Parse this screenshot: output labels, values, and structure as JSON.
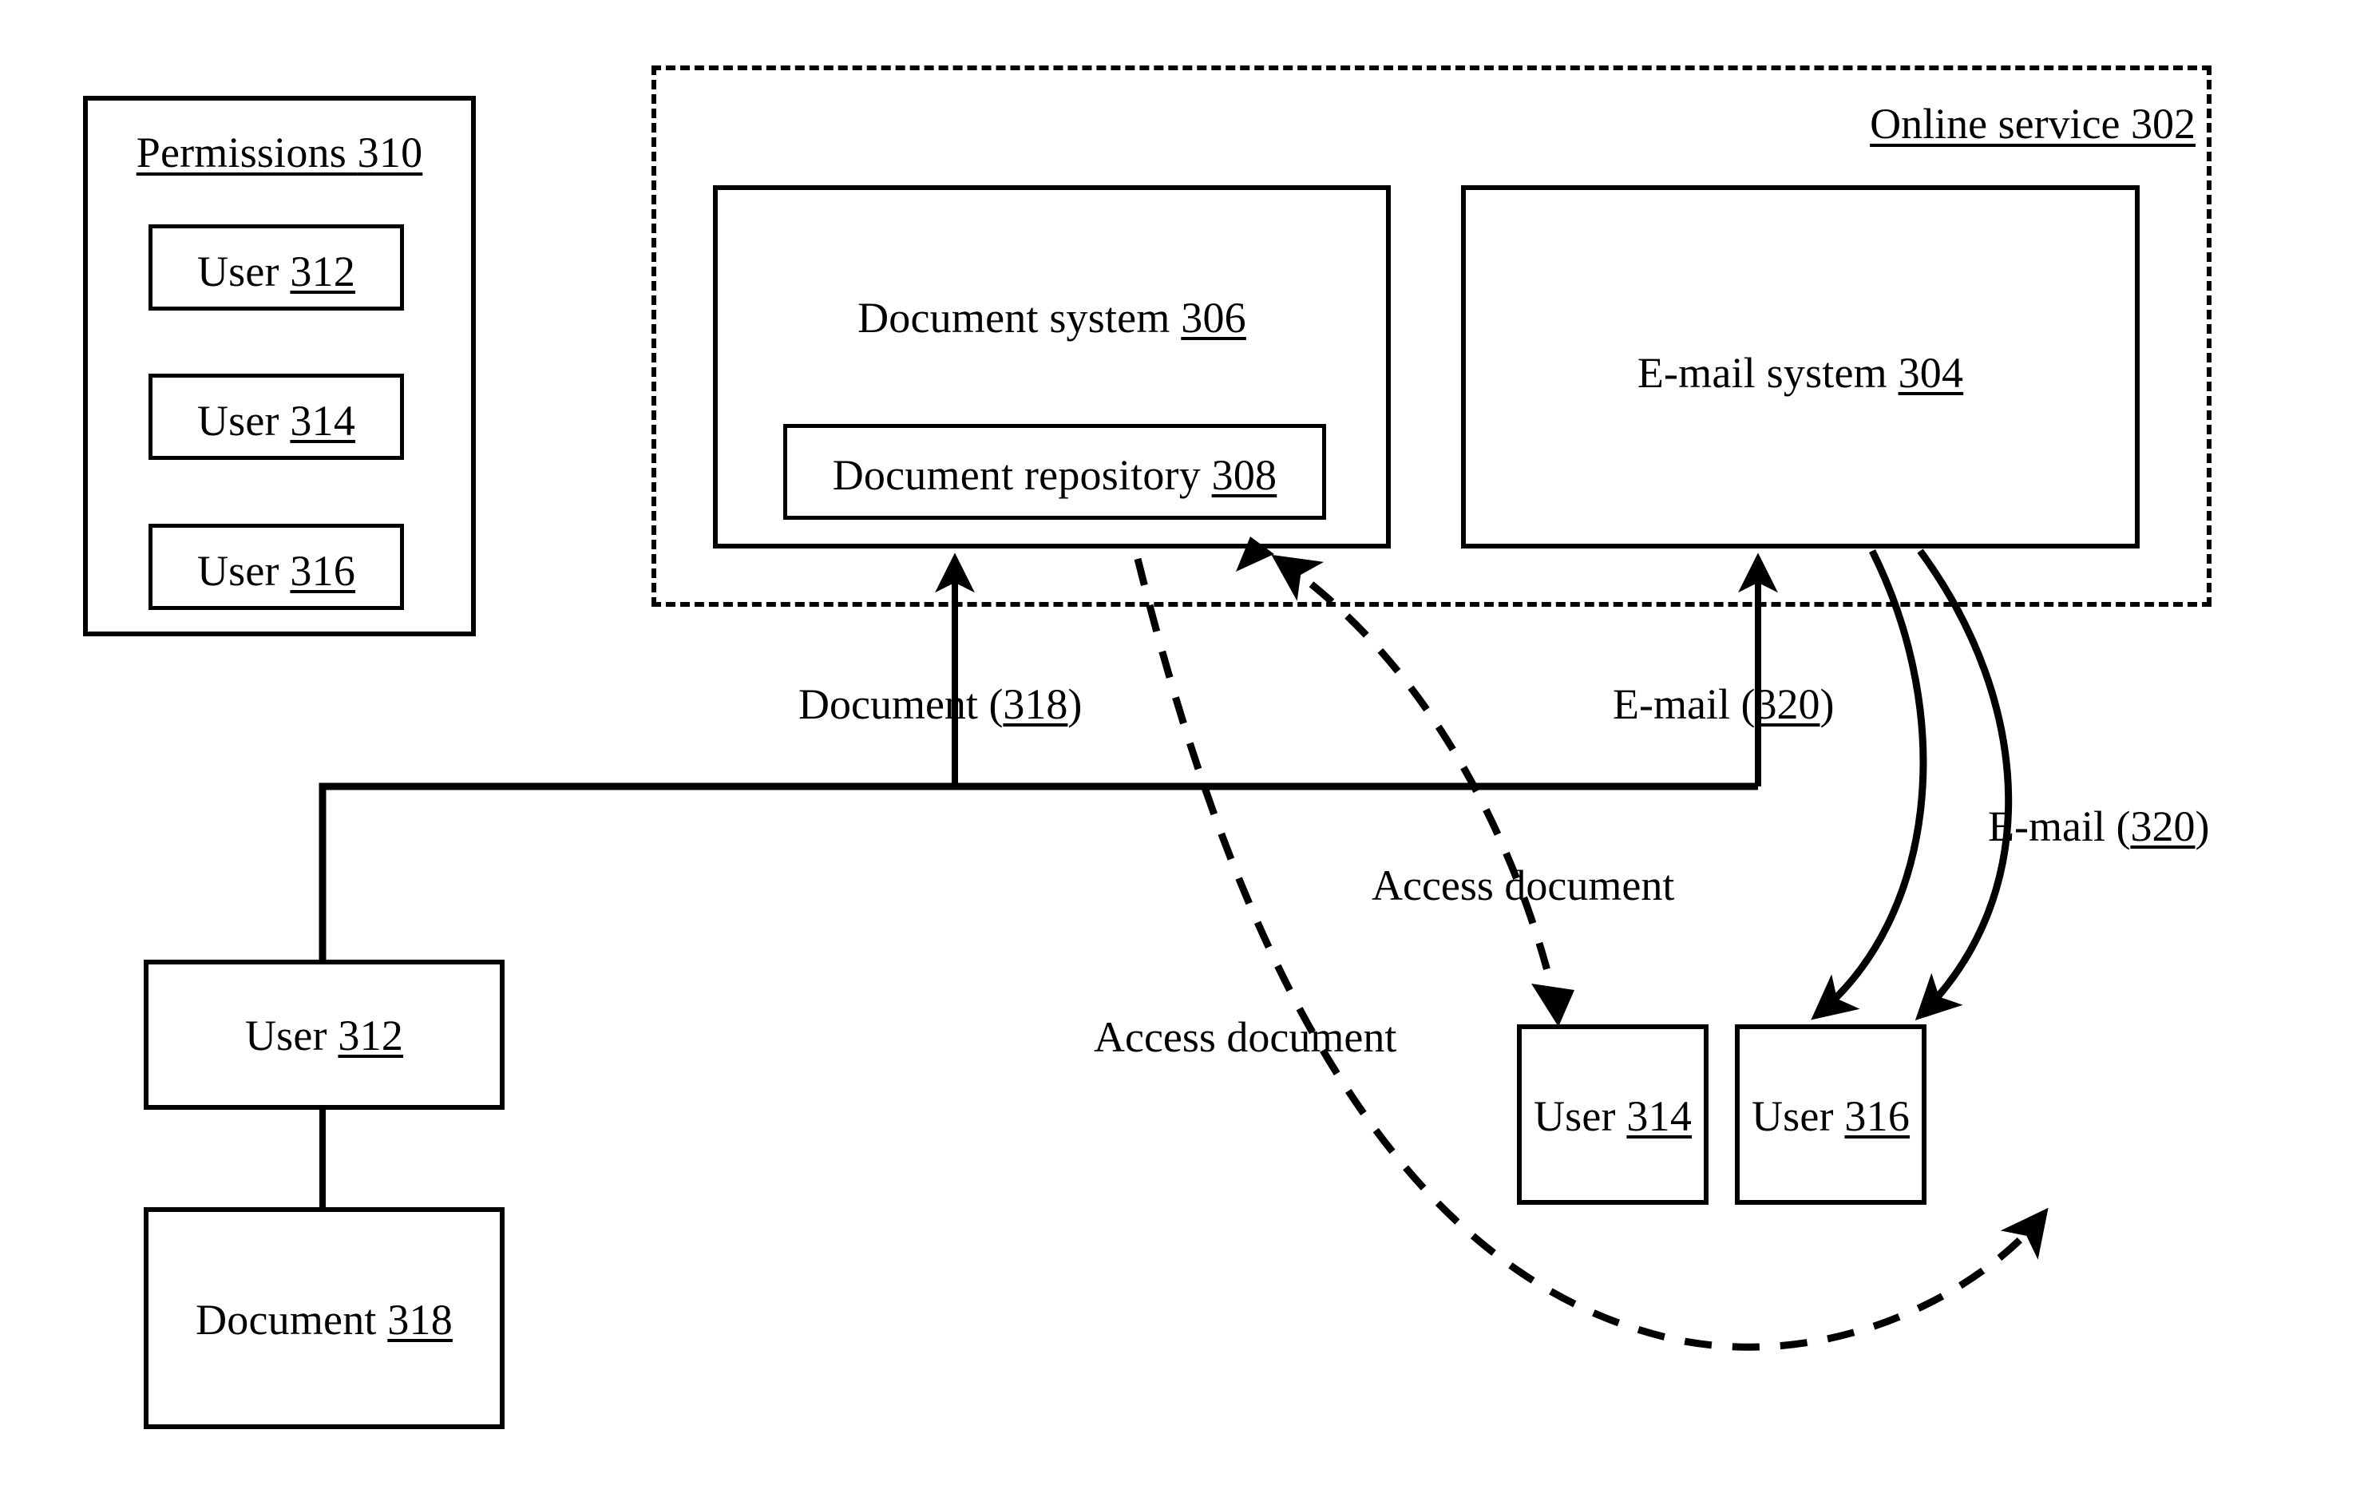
{
  "figure": {
    "title": "Online service document and e-mail sharing diagram",
    "background_color": "#ffffff",
    "line_color": "#000000"
  },
  "permissions_panel": {
    "title_text": "Permissions",
    "title_ref": "310",
    "items": [
      {
        "label": "User",
        "ref": "312"
      },
      {
        "label": "User",
        "ref": "314"
      },
      {
        "label": "User",
        "ref": "316"
      }
    ]
  },
  "online_service": {
    "label": "Online service",
    "ref": "302",
    "systems": [
      {
        "name": "document-system",
        "label": "Document system",
        "ref": "306",
        "child": {
          "name": "document-repository",
          "label": "Document repository",
          "ref": "308"
        }
      },
      {
        "name": "email-system",
        "label": "E-mail system",
        "ref": "304",
        "child": null
      }
    ]
  },
  "actors": {
    "user_312": {
      "label": "User",
      "ref": "312"
    },
    "user_314": {
      "label": "User",
      "ref": "314"
    },
    "user_316": {
      "label": "User",
      "ref": "316"
    },
    "document_318": {
      "label": "Document",
      "ref": "318"
    }
  },
  "flow_labels": {
    "document_upload": {
      "prefix": "Document (",
      "ref": "318",
      "suffix": ")"
    },
    "email_send": {
      "prefix": "E-mail (",
      "ref": "320",
      "suffix": ")"
    },
    "email_deliver": {
      "prefix": "E-mail (",
      "ref": "320",
      "suffix": ")"
    },
    "access_document_314": "Access document",
    "access_document_316": "Access document"
  },
  "edges": [
    {
      "name": "user312-to-document318",
      "style": "solid",
      "arrow": false,
      "from": "user-312",
      "to": "document-318"
    },
    {
      "name": "document318-upload-to-document-system",
      "style": "solid",
      "arrow": true,
      "from": "user-312",
      "to": "document-system"
    },
    {
      "name": "email320-to-email-system",
      "style": "solid",
      "arrow": true,
      "from": "user-312",
      "to": "email-system"
    },
    {
      "name": "email-system-to-user314",
      "style": "solid",
      "arrow": true,
      "from": "email-system",
      "to": "user-314"
    },
    {
      "name": "email-system-to-user316",
      "style": "solid",
      "arrow": true,
      "from": "email-system",
      "to": "user-316"
    },
    {
      "name": "user314-access-document",
      "style": "dashed",
      "arrow": true,
      "from": "document-system",
      "to": "user-314"
    },
    {
      "name": "user316-access-document",
      "style": "dashed",
      "arrow": true,
      "from": "user-316",
      "to": "document-system"
    }
  ]
}
